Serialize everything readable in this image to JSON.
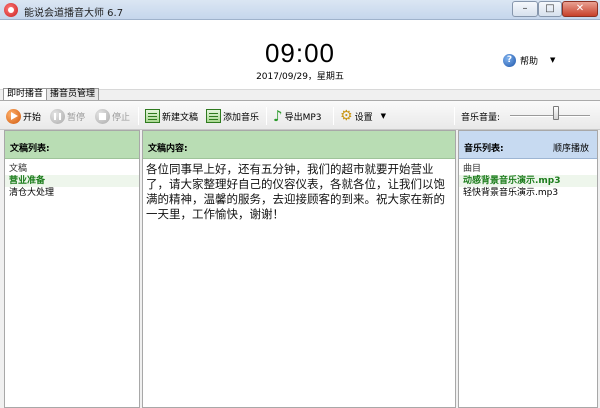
{
  "window": {
    "title": "能说会道播音大师 6.7",
    "controls": {
      "minimize": "–",
      "maximize": "□",
      "close": "✕"
    }
  },
  "header": {
    "time": "09:00",
    "date": "2017/09/29，星期五",
    "help_label": "帮助",
    "help_icon": "question-icon"
  },
  "tabs": [
    {
      "label": "即时播音",
      "active": true
    },
    {
      "label": "播音员管理",
      "active": false
    }
  ],
  "toolbar": {
    "start": "开始",
    "pause": "暂停",
    "stop": "停止",
    "new_doc": "新建文稿",
    "add_music": "添加音乐",
    "export_mp3": "导出MP3",
    "settings": "设置",
    "volume_label": "音乐音量:",
    "volume_level": 0.58
  },
  "doc_list": {
    "header": "文稿列表:",
    "items": [
      {
        "label": "文稿",
        "style": "normal"
      },
      {
        "label": "营业准备",
        "style": "selected"
      },
      {
        "label": "清仓大处理",
        "style": "normal"
      }
    ]
  },
  "content_pane": {
    "header": "文稿内容:",
    "text": "各位同事早上好，还有五分钟，我们的超市就要开始营业了，请大家整理好自己的仪容仪表，各就各位，让我们以饱满的精神，温馨的服务，去迎接顾客的到来。祝大家在新的一天里，工作愉快，谢谢！"
  },
  "music_list": {
    "header": "音乐列表:",
    "mode": "顺序播放",
    "items": [
      {
        "label": "曲目",
        "style": "normal"
      },
      {
        "label": "动感背景音乐演示.mp3",
        "style": "selected"
      },
      {
        "label": "轻快背景音乐演示.mp3",
        "style": "normal"
      }
    ]
  },
  "colors": {
    "list_header_green": "#b9ddb4",
    "list_header_blue": "#c7daf1",
    "selected_text": "#1c7d1c"
  }
}
